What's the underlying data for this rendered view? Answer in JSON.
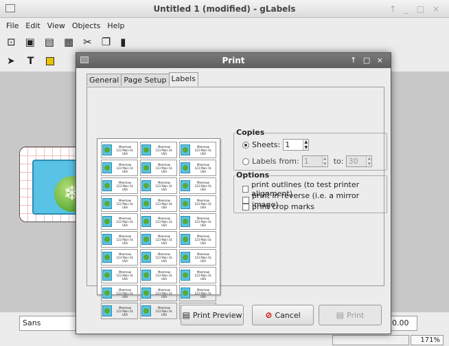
{
  "window": {
    "title": "Untitled 1 (modified) - gLabels",
    "controls": "↑ _ □ ×"
  },
  "menu": [
    "File",
    "Edit",
    "View",
    "Objects",
    "Help"
  ],
  "toolbar": {
    "icons": [
      "new-file-icon",
      "open-icon",
      "save-icon",
      "print-icon",
      "cut-icon",
      "copy-icon",
      "paste-icon"
    ]
  },
  "tools": {
    "arrow": "➤",
    "text": "T"
  },
  "status": {
    "font": "Sans",
    "size": "0.00",
    "zoom": "171%"
  },
  "dialog": {
    "title": "Print",
    "controls": "↑ □ ×",
    "tabs": [
      "General",
      "Page Setup",
      "Labels"
    ],
    "active_tab": "Labels",
    "copies": {
      "title": "Copies",
      "sheets_label": "Sheets:",
      "sheets_value": "1",
      "labels_label": "Labels",
      "from_label": "from:",
      "from_value": "1",
      "to_label": "to:",
      "to_value": "30"
    },
    "options": {
      "title": "Options",
      "items": [
        "print outlines (to test printer alignment)",
        "print in reverse (i.e. a mirror image)",
        "print crop marks"
      ]
    },
    "buttons": {
      "preview": "Print Preview",
      "cancel": "Cancel",
      "print": "Print"
    },
    "mini_label": [
      "Meemaw",
      "123 Main St.",
      "USA"
    ]
  }
}
